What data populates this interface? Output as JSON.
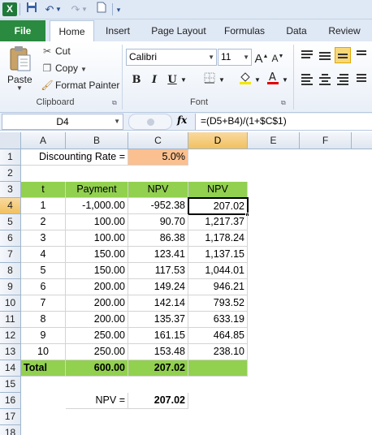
{
  "app": {
    "logo": "X"
  },
  "ribbon": {
    "tabs": [
      "File",
      "Home",
      "Insert",
      "Page Layout",
      "Formulas",
      "Data",
      "Review"
    ],
    "clipboard": {
      "paste": "Paste",
      "cut": "Cut",
      "copy": "Copy",
      "format_painter": "Format Painter",
      "label": "Clipboard"
    },
    "font": {
      "name": "Calibri",
      "size": "11",
      "label": "Font",
      "bold": "B",
      "italic": "I",
      "underline": "U",
      "grow": "A",
      "shrink": "A"
    }
  },
  "formula_bar": {
    "name_box": "D4",
    "fx": "fx",
    "formula": "=(D5+B4)/(1+$C$1)"
  },
  "columns": [
    "A",
    "B",
    "C",
    "D",
    "E",
    "F"
  ],
  "rows": [
    "1",
    "2",
    "3",
    "4",
    "5",
    "6",
    "7",
    "8",
    "9",
    "10",
    "11",
    "12",
    "13",
    "14",
    "15",
    "16",
    "17",
    "18"
  ],
  "cells": {
    "discount_label": "Discounting Rate =",
    "discount_value": "5.0%",
    "headers": {
      "t": "t",
      "payment": "Payment",
      "npv_c": "NPV",
      "npv_d": "NPV"
    },
    "table": [
      {
        "t": "1",
        "payment": "-1,000.00",
        "npv_c": "-952.38",
        "npv_d": "207.02"
      },
      {
        "t": "2",
        "payment": "100.00",
        "npv_c": "90.70",
        "npv_d": "1,217.37"
      },
      {
        "t": "3",
        "payment": "100.00",
        "npv_c": "86.38",
        "npv_d": "1,178.24"
      },
      {
        "t": "4",
        "payment": "150.00",
        "npv_c": "123.41",
        "npv_d": "1,137.15"
      },
      {
        "t": "5",
        "payment": "150.00",
        "npv_c": "117.53",
        "npv_d": "1,044.01"
      },
      {
        "t": "6",
        "payment": "200.00",
        "npv_c": "149.24",
        "npv_d": "946.21"
      },
      {
        "t": "7",
        "payment": "200.00",
        "npv_c": "142.14",
        "npv_d": "793.52"
      },
      {
        "t": "8",
        "payment": "200.00",
        "npv_c": "135.37",
        "npv_d": "633.19"
      },
      {
        "t": "9",
        "payment": "250.00",
        "npv_c": "161.15",
        "npv_d": "464.85"
      },
      {
        "t": "10",
        "payment": "250.00",
        "npv_c": "153.48",
        "npv_d": "238.10"
      }
    ],
    "total": {
      "label": "Total",
      "payment": "600.00",
      "npv_c": "207.02"
    },
    "npv_label": "NPV =",
    "npv_value": "207.02"
  },
  "colors": {
    "header_green": "#92d050",
    "rate_orange": "#fac090",
    "file_tab": "#2a8a3f"
  }
}
